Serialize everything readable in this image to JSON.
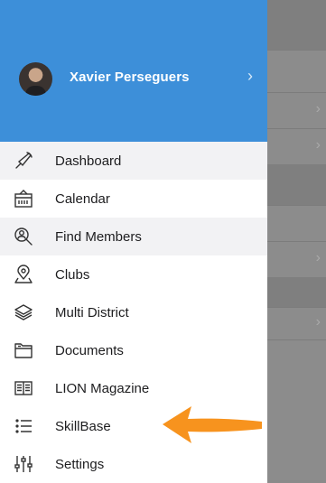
{
  "profile": {
    "name": "Xavier Perseguers"
  },
  "menu": [
    {
      "label": "Dashboard",
      "icon": "dashboard-icon"
    },
    {
      "label": "Calendar",
      "icon": "calendar-icon"
    },
    {
      "label": "Find Members",
      "icon": "find-members-icon"
    },
    {
      "label": "Clubs",
      "icon": "location-pin-icon"
    },
    {
      "label": "Multi District",
      "icon": "layers-icon"
    },
    {
      "label": "Documents",
      "icon": "folder-icon"
    },
    {
      "label": "LION Magazine",
      "icon": "book-icon"
    },
    {
      "label": "SkillBase",
      "icon": "list-icon"
    },
    {
      "label": "Settings",
      "icon": "settings-sliders-icon"
    }
  ],
  "colors": {
    "header": "#3d8fd9",
    "arrow": "#f7931e",
    "overlay": "#8c8c8c"
  }
}
